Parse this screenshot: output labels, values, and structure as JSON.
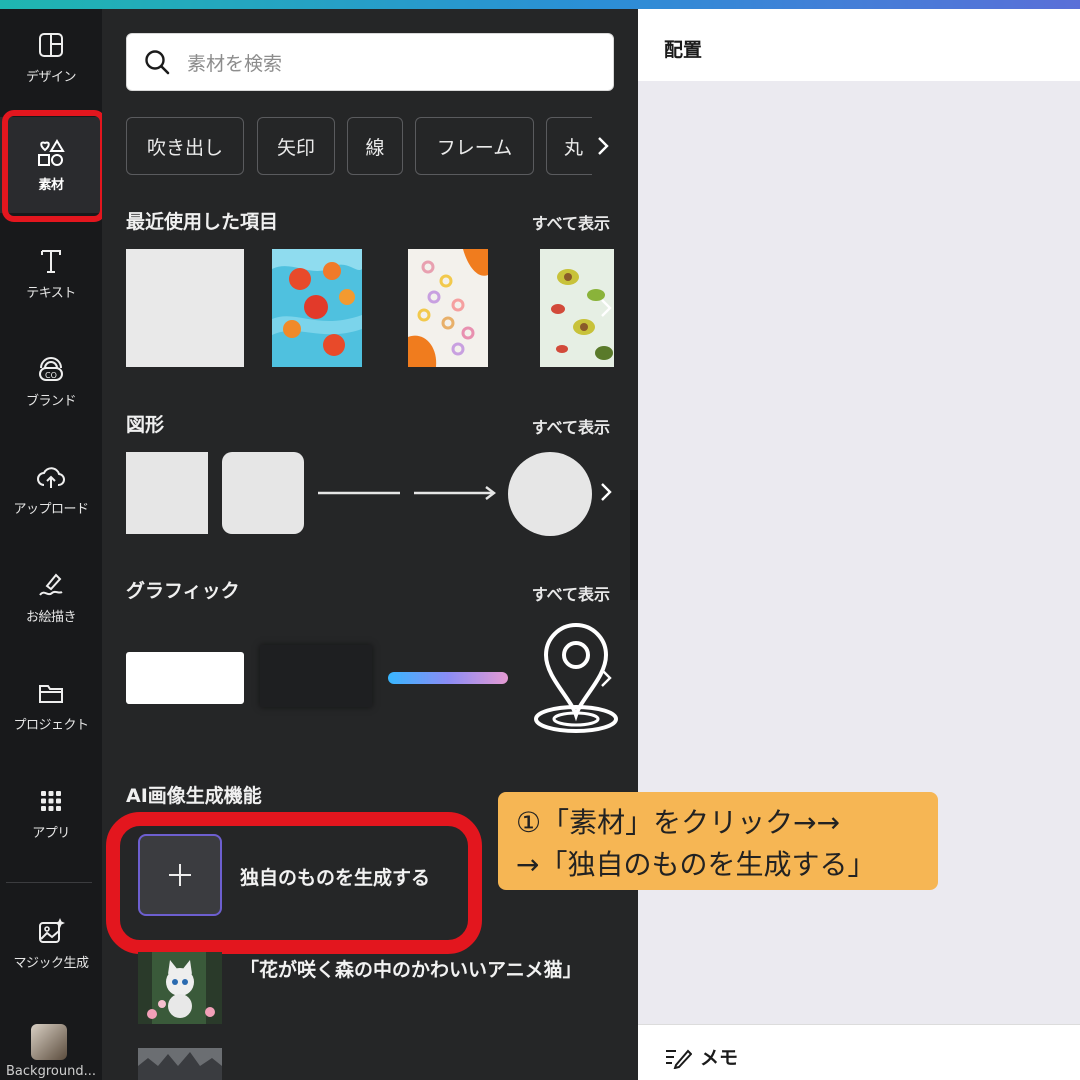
{
  "rail": {
    "items": [
      {
        "label": "デザイン",
        "icon": "layout-icon"
      },
      {
        "label": "素材",
        "icon": "elements-icon"
      },
      {
        "label": "テキスト",
        "icon": "text-icon"
      },
      {
        "label": "ブランド",
        "icon": "brand-icon"
      },
      {
        "label": "アップロード",
        "icon": "cloud-upload-icon"
      },
      {
        "label": "お絵描き",
        "icon": "draw-icon"
      },
      {
        "label": "プロジェクト",
        "icon": "folder-icon"
      },
      {
        "label": "アプリ",
        "icon": "apps-grid-icon"
      },
      {
        "label": "マジック生成",
        "icon": "magic-image-icon"
      }
    ],
    "recent_label": "Background..."
  },
  "search": {
    "placeholder": "素材を検索"
  },
  "chips": [
    "吹き出し",
    "矢印",
    "線",
    "フレーム",
    "丸"
  ],
  "sections": {
    "recent": {
      "title": "最近使用した項目",
      "link": "すべて表示"
    },
    "shapes": {
      "title": "図形",
      "link": "すべて表示"
    },
    "graphics": {
      "title": "グラフィック",
      "link": "すべて表示"
    },
    "ai": {
      "title": "AI画像生成機能"
    }
  },
  "ai": {
    "generate_label": "独自のものを生成する",
    "item_label": "「花が咲く森の中のかわいいアニメ猫」"
  },
  "right": {
    "title": "配置",
    "memo": "メモ"
  },
  "note": {
    "line1": "①「素材」をクリック→→",
    "line2": "→「独自のものを生成する」"
  },
  "colors": {
    "accent_red": "#e3161e",
    "note_bg": "#f6b654",
    "panel_bg": "#252627",
    "rail_bg": "#18191b"
  }
}
